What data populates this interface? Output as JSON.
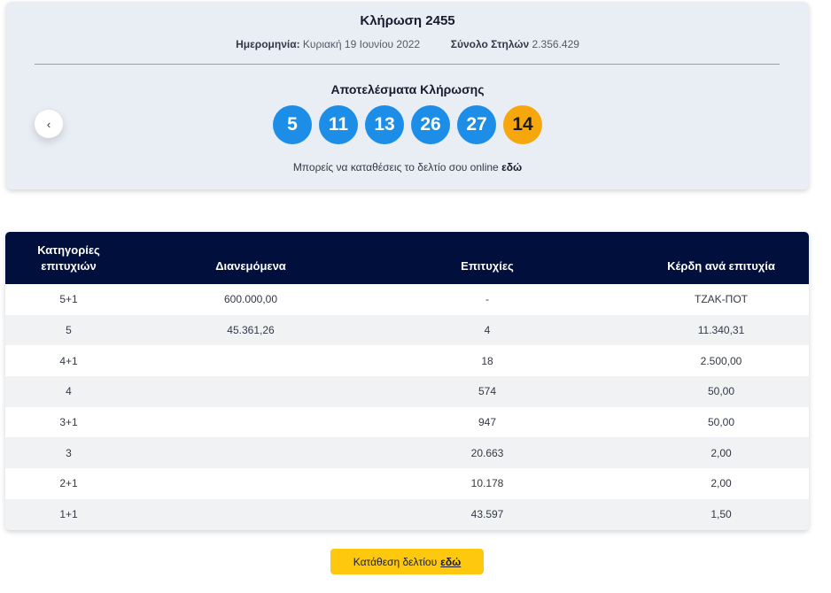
{
  "draw": {
    "title": "Κλήρωση 2455",
    "date_label": "Ημερομηνία:",
    "date_value": "Κυριακή 19 Ιουνίου 2022",
    "columns_label": "Σύνολο Στηλών",
    "columns_value": "2.356.429",
    "results_title": "Αποτελέσματα Κλήρωσης",
    "numbers": [
      "5",
      "11",
      "13",
      "26",
      "27"
    ],
    "bonus": "14",
    "online_text": "Μπορείς να καταθέσεις το δελτίο σου online",
    "online_link": "εδώ",
    "prev_icon": "‹"
  },
  "colors": {
    "ball": "#1c8ee8",
    "bonus_ball": "#f6a70d",
    "table_header": "#010f3c",
    "button": "#fdc80e"
  },
  "chart_data": {
    "type": "table",
    "columns": [
      "Κατηγορίες επιτυχιών",
      "Διανεμόμενα",
      "Επιτυχίες",
      "Κέρδη ανά επιτυχία"
    ],
    "rows": [
      [
        "5+1",
        "600.000,00",
        "-",
        "ΤΖΑΚ-ΠΟΤ"
      ],
      [
        "5",
        "45.361,26",
        "4",
        "11.340,31"
      ],
      [
        "4+1",
        "",
        "18",
        "2.500,00"
      ],
      [
        "4",
        "",
        "574",
        "50,00"
      ],
      [
        "3+1",
        "",
        "947",
        "50,00"
      ],
      [
        "3",
        "",
        "20.663",
        "2,00"
      ],
      [
        "2+1",
        "",
        "10.178",
        "2,00"
      ],
      [
        "1+1",
        "",
        "43.597",
        "1,50"
      ]
    ]
  },
  "submit": {
    "label": "Κατάθεση δελτίου",
    "link": "εδώ"
  }
}
